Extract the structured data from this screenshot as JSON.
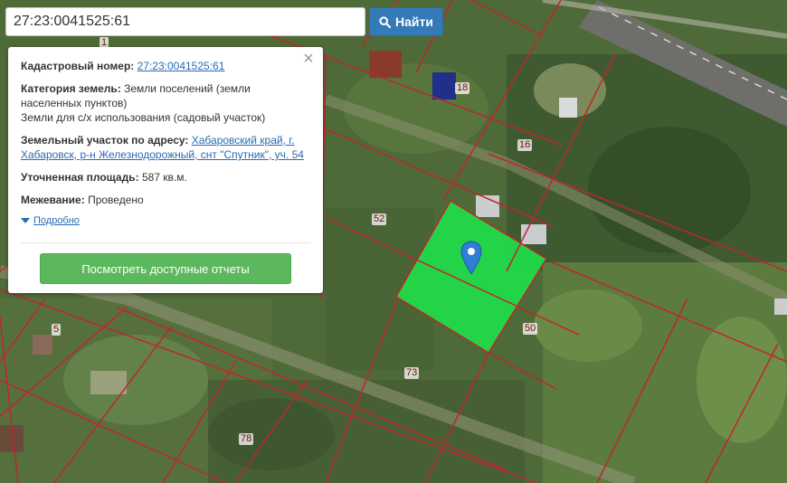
{
  "search": {
    "value": "27:23:0041525:61",
    "button_label": "Найти",
    "button_icon": "search-icon"
  },
  "popup": {
    "cadastral_label": "Кадастровый номер:",
    "cadastral_value": "27:23:0041525:61",
    "category_label": "Категория земель:",
    "category_value_1": "Земли поселений (земли населенных пунктов)",
    "category_value_2": "Земли для с/х использования (садовый участок)",
    "address_label": "Земельный участок по адресу:",
    "address_value": "Хабаровский край, г. Хабаровск, р-н Железнодорожный, снт \"Спутник\", уч. 54",
    "area_label": "Уточненная площадь:",
    "area_value": "587 кв.м.",
    "survey_label": "Межевание:",
    "survey_value": "Проведено",
    "details_link": "Подробно",
    "reports_button": "Посмотреть доступные отчеты",
    "close_icon": "close-icon"
  },
  "map": {
    "parcel_labels": [
      "1",
      "18",
      "16",
      "52",
      "5",
      "50",
      "73",
      "78"
    ],
    "parcel_icon": "map-pin-icon",
    "highlight_color": "#1fe04a",
    "boundary_color": "#c0262d"
  }
}
